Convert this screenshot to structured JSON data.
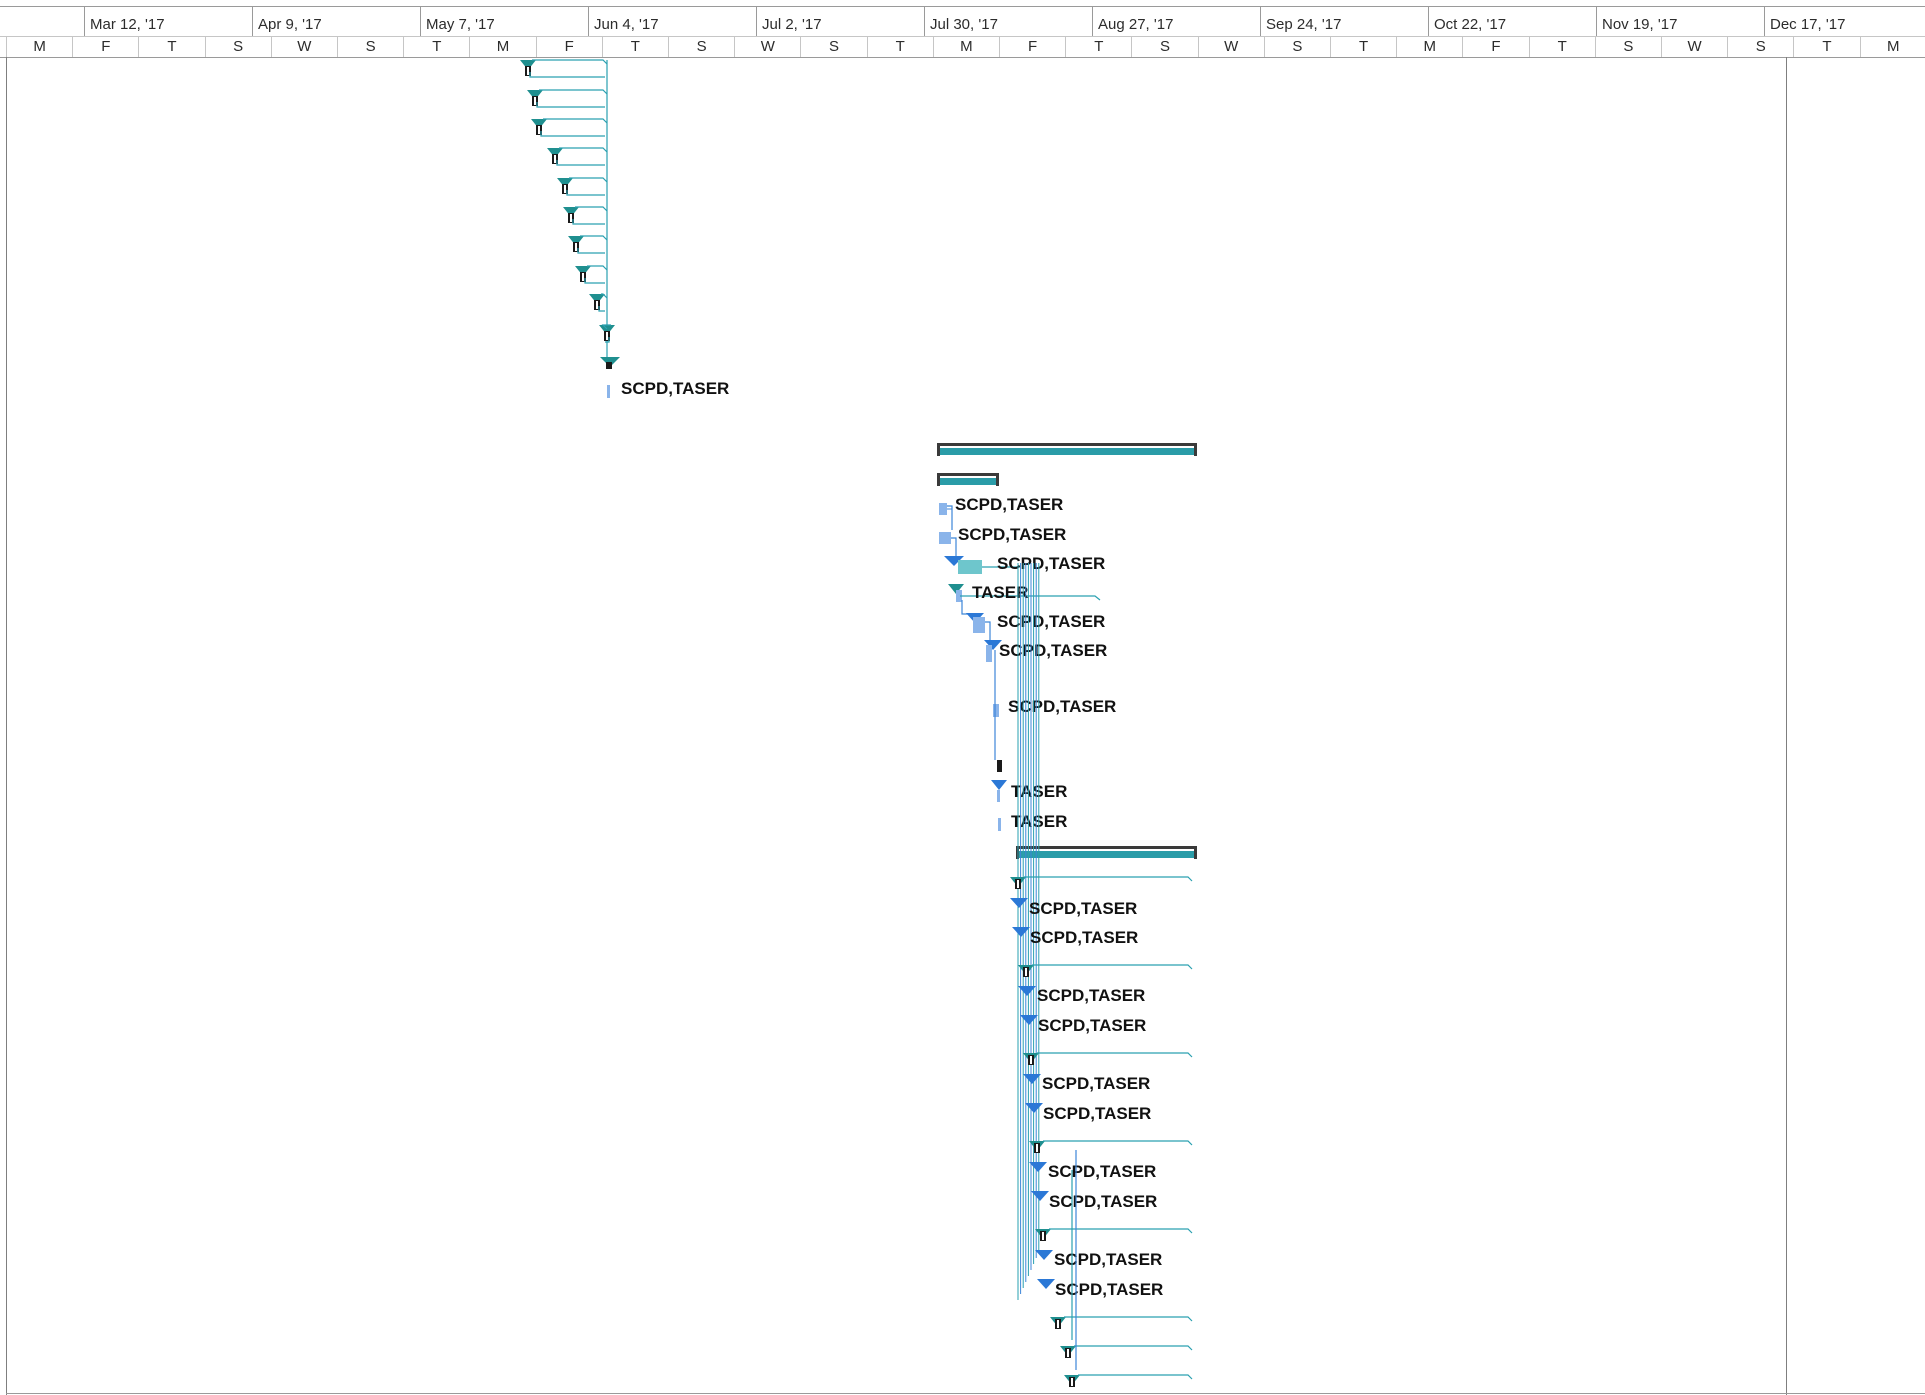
{
  "timescale": {
    "major": [
      "Mar 12, '17",
      "Apr 9, '17",
      "May 7, '17",
      "Jun 4, '17",
      "Jul 2, '17",
      "Jul 30, '17",
      "Aug 27, '17",
      "Sep 24, '17",
      "Oct 22, '17",
      "Nov 19, '17",
      "Dec 17, '17"
    ],
    "minor": [
      "M",
      "F",
      "T",
      "S",
      "W",
      "S",
      "T",
      "M",
      "F",
      "T",
      "S",
      "W",
      "S",
      "T",
      "M",
      "F",
      "T",
      "S",
      "W",
      "S",
      "T",
      "M",
      "F",
      "T",
      "S",
      "W",
      "S",
      "T",
      "M"
    ]
  },
  "bar_labels": [
    "SCPD,TASER",
    "SCPD,TASER",
    "SCPD,TASER",
    "SCPD,TASER",
    "TASER",
    "SCPD,TASER",
    "SCPD,TASER",
    "SCPD,TASER",
    "TASER",
    "TASER",
    "SCPD,TASER",
    "SCPD,TASER",
    "SCPD,TASER",
    "SCPD,TASER",
    "SCPD,TASER",
    "SCPD,TASER",
    "SCPD,TASER",
    "SCPD,TASER",
    "SCPD,TASER",
    "SCPD,TASER"
  ],
  "colors": {
    "summary_bar": "#2a9ca8",
    "summary_border": "#3a3a3a",
    "task_bar": "#8ab4ea",
    "critical_task": "#1f8a8a",
    "milestone": "#2b78d6",
    "milestone_teal": "#1f8f8f",
    "link_line": "#2aa0b0",
    "link_blue": "#3d86d8"
  }
}
